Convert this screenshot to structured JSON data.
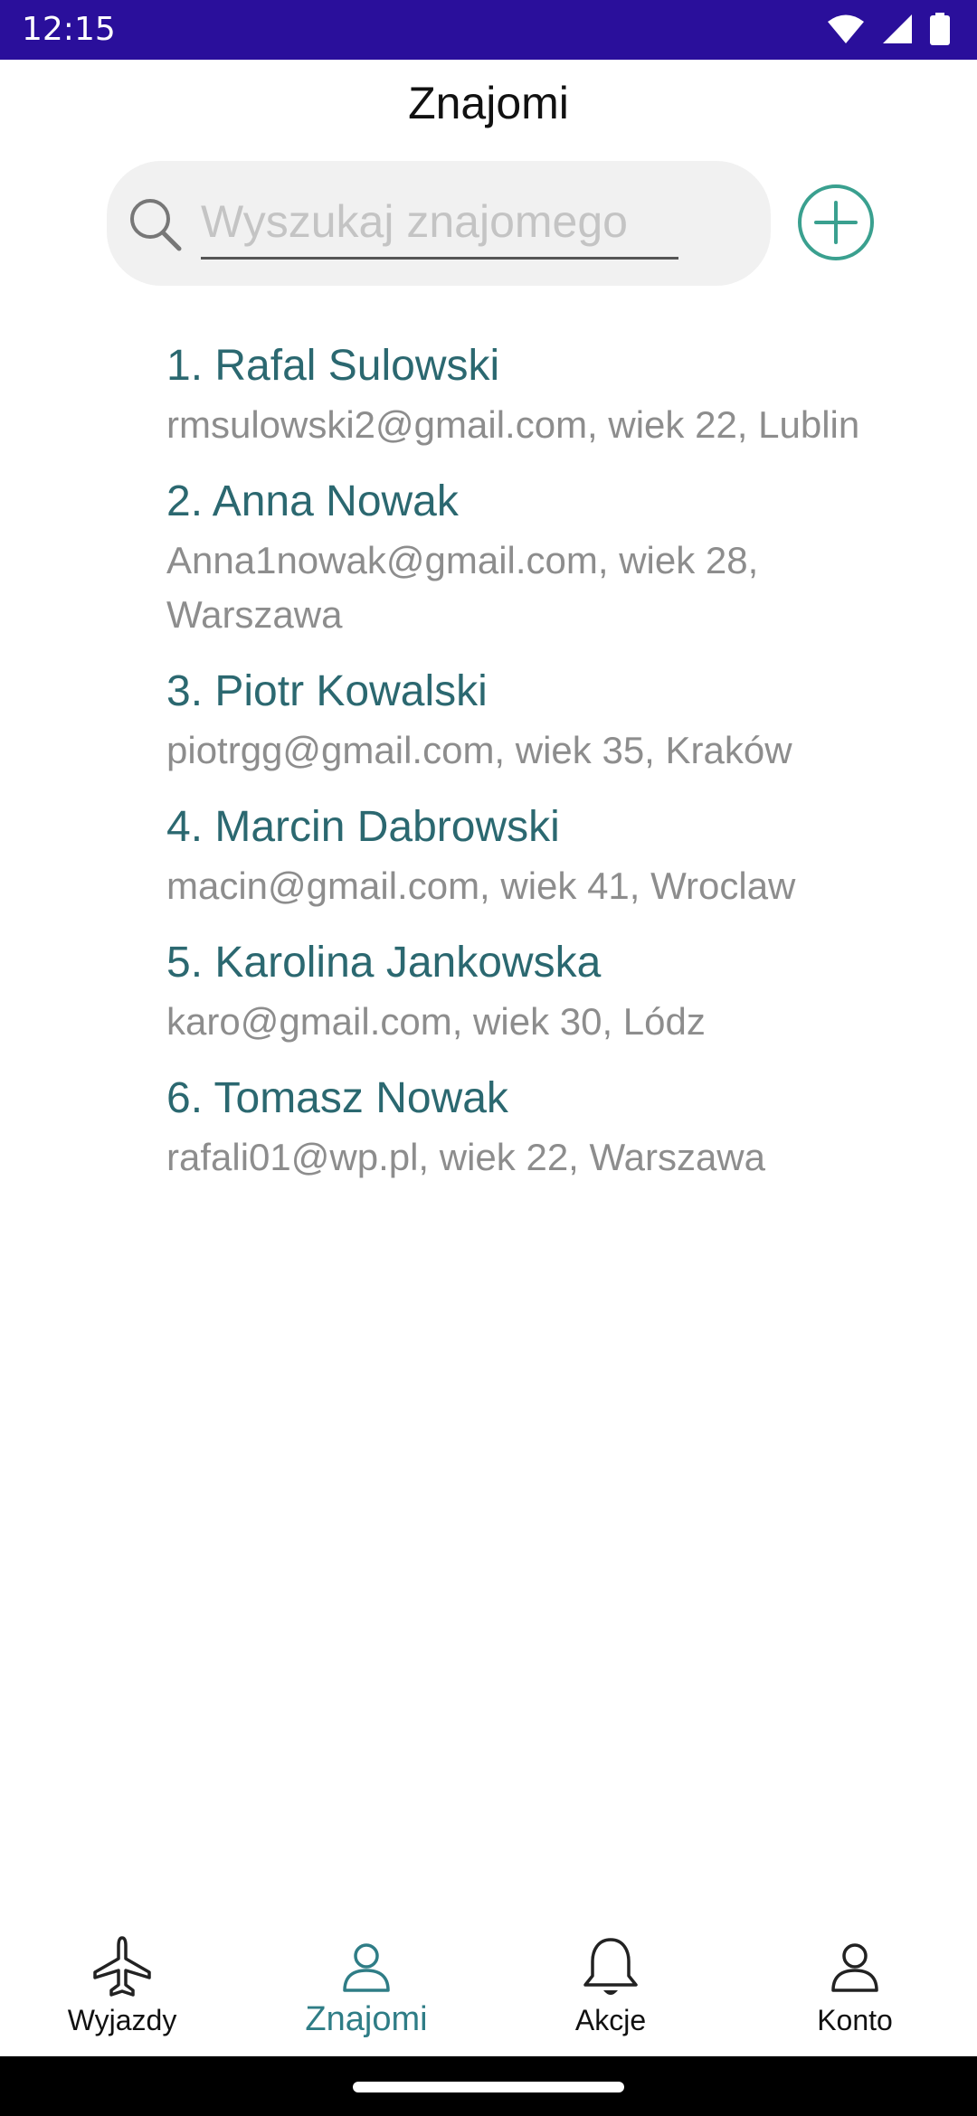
{
  "status_bar": {
    "time": "12:15",
    "icons": [
      "wifi-icon",
      "signal-icon",
      "battery-icon"
    ]
  },
  "header": {
    "title": "Znajomi"
  },
  "search": {
    "placeholder": "Wyszukaj znajomego",
    "value": "",
    "icon": "search-icon"
  },
  "add_button": {
    "icon": "plus-circle-icon",
    "color": "#3aa08f"
  },
  "friends": [
    {
      "name": "1. Rafal Sulowski",
      "info": "rmsulowski2@gmail.com, wiek 22, Lublin"
    },
    {
      "name": "2. Anna Nowak",
      "info": "Anna1nowak@gmail.com, wiek 28, Warszawa"
    },
    {
      "name": "3. Piotr Kowalski",
      "info": "piotrgg@gmail.com, wiek 35, Kraków"
    },
    {
      "name": "4. Marcin Dabrowski",
      "info": "macin@gmail.com, wiek 41, Wroclaw"
    },
    {
      "name": "5. Karolina Jankowska",
      "info": "karo@gmail.com, wiek 30, Lódz"
    },
    {
      "name": "6. Tomasz Nowak",
      "info": "rafali01@wp.pl, wiek 22, Warszawa"
    }
  ],
  "bottom_nav": {
    "items": [
      {
        "label": "Wyjazdy",
        "icon": "airplane-icon",
        "active": false
      },
      {
        "label": "Znajomi",
        "icon": "person-icon",
        "active": true
      },
      {
        "label": "Akcje",
        "icon": "bell-icon",
        "active": false
      },
      {
        "label": "Konto",
        "icon": "account-icon",
        "active": false
      }
    ]
  },
  "colors": {
    "status_bar": "#2a0f9b",
    "accent": "#2f7d86",
    "name_text": "#2b6870",
    "secondary_text": "#8d8d8d"
  }
}
